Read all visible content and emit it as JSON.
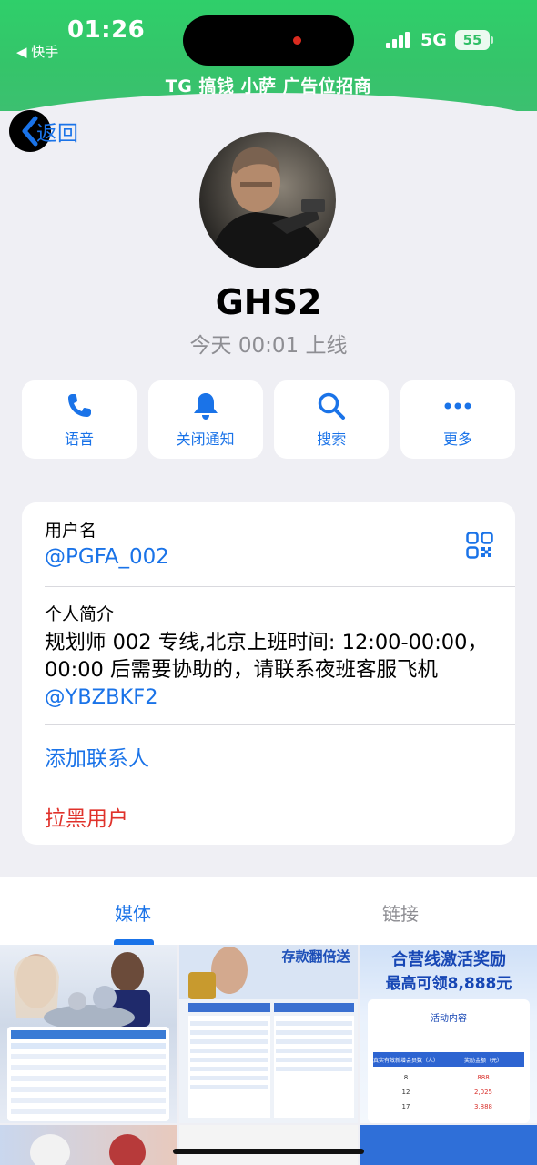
{
  "status_bar": {
    "time": "01:26",
    "back_app": "◀ 快手",
    "network": "5G",
    "battery": "55"
  },
  "banner": {
    "text": "TG 搞钱  小萨 广告位招商"
  },
  "nav": {
    "back_label": "返回"
  },
  "profile": {
    "name": "GHS2",
    "last_seen": "今天 00:01 上线"
  },
  "actions": [
    {
      "label": "语音",
      "icon": "phone-icon"
    },
    {
      "label": "关闭通知",
      "icon": "bell-icon"
    },
    {
      "label": "搜索",
      "icon": "search-icon"
    },
    {
      "label": "更多",
      "icon": "more-icon"
    }
  ],
  "info": {
    "username_label": "用户名",
    "username_value": "@PGFA_002",
    "bio_label": "个人简介",
    "bio_text": "规划师 002 专线,北京上班时间: 12:00-00:00，00:00 后需要协助的，请联系夜班客服飞机 ",
    "bio_mention": "@YBZBKF2",
    "add_contact": "添加联系人",
    "block_user": "拉黑用户"
  },
  "tabs": {
    "media": "媒体",
    "links": "链接"
  },
  "media": {
    "tile1_banner": "",
    "tile2_title": "存款翻倍送",
    "tile3_title": "合营线激活奖励",
    "tile3_subtitle": "最高可领8,888元",
    "tile3_section": "活动内容",
    "tile3_col1": "真实有效新增会员数（人）",
    "tile3_col2": "奖励金额（元）",
    "tile3_rows": [
      {
        "count": "8",
        "amount": "888"
      },
      {
        "count": "12",
        "amount": "2,025"
      },
      {
        "count": "17",
        "amount": "3,888"
      }
    ]
  },
  "colors": {
    "accent": "#1a73e8",
    "danger": "#e0322b",
    "banner": "#35c46a"
  }
}
